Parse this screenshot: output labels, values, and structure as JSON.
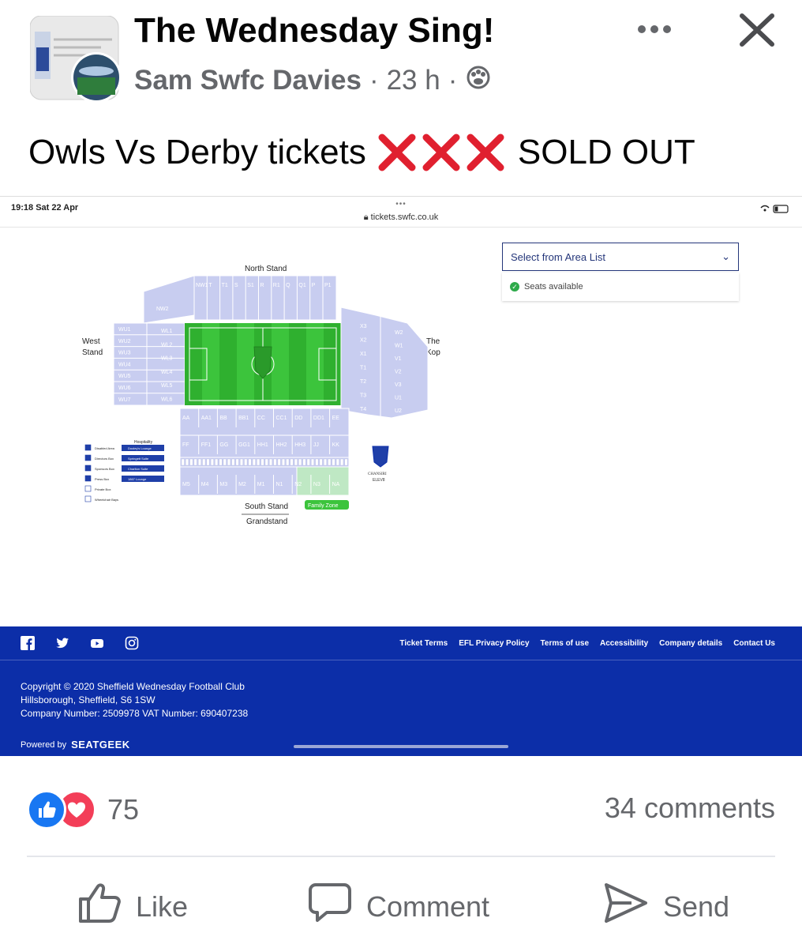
{
  "post": {
    "group_name": "The Wednesday Sing!",
    "author": "Sam Swfc Davies",
    "separator": "·",
    "time": "23 h",
    "text_before": "Owls Vs Derby tickets",
    "text_after": "SOLD OUT",
    "x_marks": [
      "❌",
      "❌",
      "❌"
    ]
  },
  "screenshot": {
    "status_time": "19:18  Sat 22 Apr",
    "tab_dots": "•••",
    "url": "tickets.swfc.co.uk",
    "area_select": {
      "label": "Select from Area List",
      "caret": "⌄"
    },
    "legend": {
      "check": "✓",
      "label": "Seats available"
    },
    "stadium": {
      "north": "North Stand",
      "west_line1": "West",
      "west_line2": "Stand",
      "kop_line1": "The",
      "kop_line2": "Kop",
      "south": "South Stand",
      "grandstand": "Grandstand",
      "family_zone": "Family Zone",
      "north_blocks": [
        "NW1",
        "T",
        "T1",
        "S",
        "S1",
        "R",
        "R1",
        "Q",
        "Q1",
        "P",
        "P1"
      ],
      "west_blocks": [
        "WU1",
        "WU2",
        "WU3",
        "WU4",
        "WU5",
        "WU6",
        "WU7"
      ],
      "west_lower_blocks": [
        "WL1",
        "WL2",
        "WL3",
        "WL4",
        "WL5",
        "WL6"
      ],
      "kop_blocks": [
        "X3",
        "X2",
        "X1",
        "T1",
        "T2",
        "T3",
        "T4"
      ],
      "kop_outer_blocks": [
        "W2",
        "W1",
        "V1",
        "V2",
        "V3",
        "U1",
        "U2"
      ],
      "south_upper_blocks": [
        "AA",
        "AA1",
        "BB",
        "BB1",
        "CC",
        "CC1",
        "DD",
        "DD1",
        "EE"
      ],
      "south_mid_blocks": [
        "FF",
        "FF1",
        "GG",
        "GG1",
        "HH1",
        "HH2",
        "HH3",
        "JJ",
        "KK"
      ],
      "south_lower_blocks": [
        "M5",
        "M4",
        "M3",
        "M2",
        "M1",
        "N1",
        "N2",
        "N3",
        "NA"
      ],
      "nw2": "NW2",
      "hospitality_title": "Hospitality",
      "key_items": [
        "Disabled Area",
        "Directors Box",
        "Sponsors Box",
        "Press Box",
        "Private Box",
        "Wheelchair Bays"
      ],
      "hospitality_items": [
        "Dooley's Lounge",
        "Springett Suite",
        "Charlton Suite",
        "1867 Lounge"
      ],
      "crest_text_1": "CHANSIRI",
      "crest_text_2": "ELEV8"
    },
    "footer": {
      "links": [
        "Ticket Terms",
        "EFL Privacy Policy",
        "Terms of use",
        "Accessibility",
        "Company details",
        "Contact Us"
      ],
      "copyright": "Copyright © 2020 Sheffield Wednesday Football Club",
      "address": "Hillsborough, Sheffield, S6 1SW",
      "company": "Company Number: 2509978 VAT Number: 690407238",
      "powered_by": "Powered by",
      "brand": "SEATGEEK"
    }
  },
  "reactions": {
    "count": "75",
    "comments": "34 comments"
  },
  "actions": {
    "like": "Like",
    "comment": "Comment",
    "send": "Send"
  },
  "colors": {
    "fb_blue": "#1877f2",
    "love_red": "#f33e58",
    "footer_blue": "#0c2ea8",
    "pitch_green": "#3cc43c"
  }
}
